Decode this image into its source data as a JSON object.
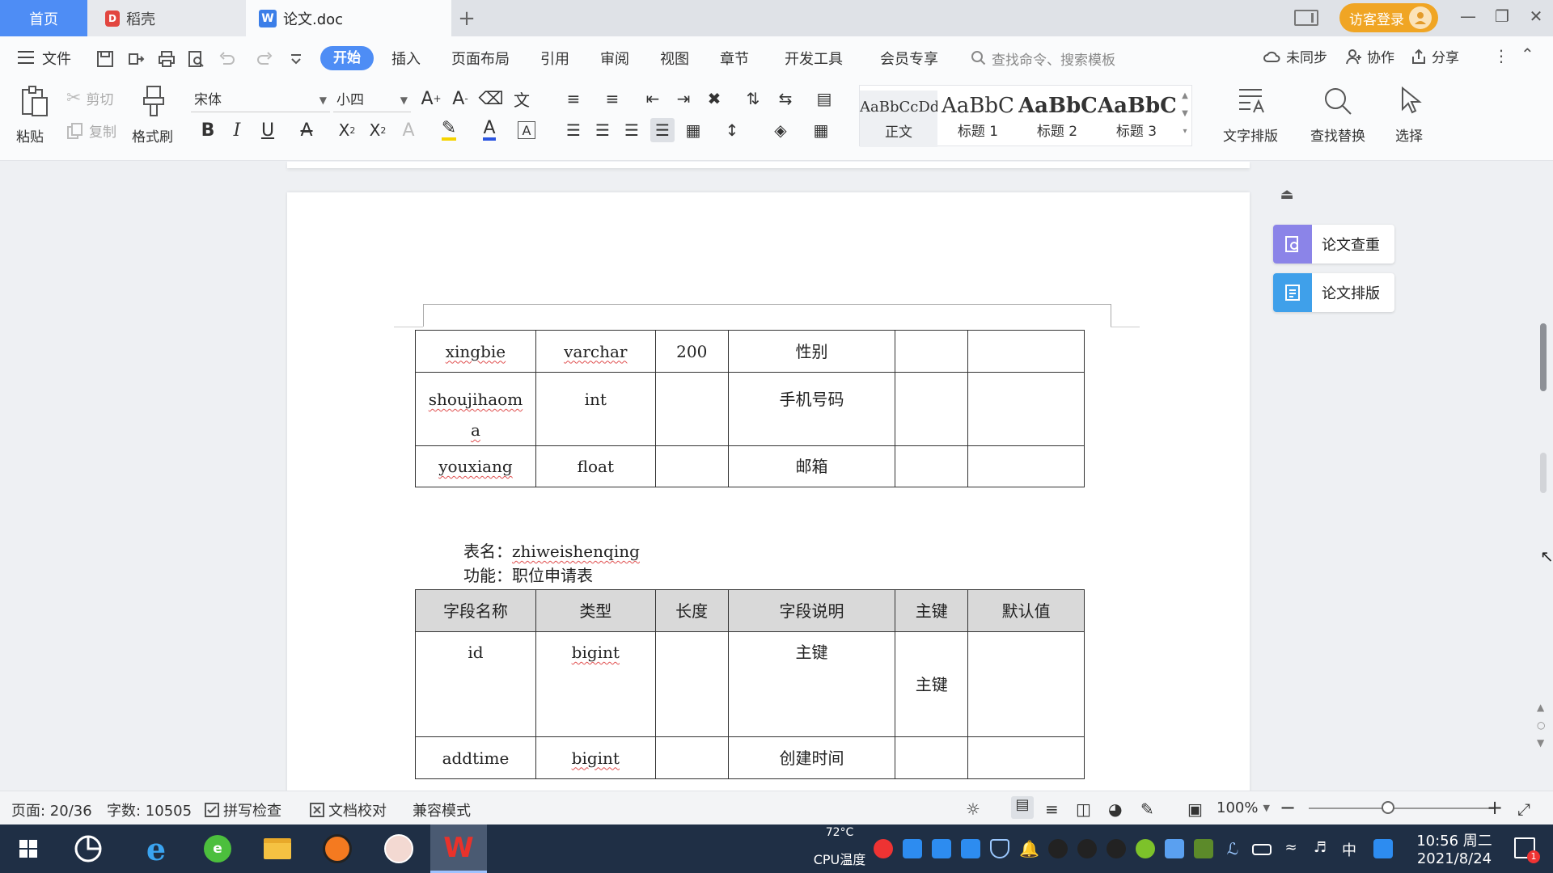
{
  "tabs": {
    "home": "首页",
    "daoke": "稻壳",
    "doc": "论文.doc",
    "add": "+"
  },
  "titlebar": {
    "guest_login": "访客登录"
  },
  "menu": {
    "file": "文件",
    "items": [
      "开始",
      "插入",
      "页面布局",
      "引用",
      "审阅",
      "视图",
      "章节",
      "开发工具",
      "会员专享"
    ],
    "search_placeholder": "查找命令、搜索模板",
    "unsynced": "未同步",
    "collab": "协作",
    "share": "分享"
  },
  "ribbon": {
    "paste": "粘贴",
    "cut": "剪切",
    "copy": "复制",
    "format_painter": "格式刷",
    "font_name": "宋体",
    "font_size": "小四",
    "styles": [
      {
        "sample": "AaBbCcDd",
        "name": "正文"
      },
      {
        "sample": "AaBbC",
        "name": "标题 1"
      },
      {
        "sample": "AaBbC",
        "name": "标题 2"
      },
      {
        "sample": "AaBbC",
        "name": "标题 3"
      }
    ],
    "text_layout": "文字排版",
    "find_replace": "查找替换",
    "select": "选择"
  },
  "document": {
    "table1": [
      {
        "name": "xingbie",
        "type": "varchar",
        "length": "200",
        "desc": "性别",
        "key": "",
        "default": ""
      },
      {
        "name": "shoujihaoma",
        "type": "int",
        "length": "",
        "desc": "手机号码",
        "key": "",
        "default": ""
      },
      {
        "name": "youxiang",
        "type": "float",
        "length": "",
        "desc": "邮箱",
        "key": "",
        "default": ""
      }
    ],
    "table2_name_label": "表名：",
    "table2_name": "zhiweishenqing",
    "table2_func_label": "功能：",
    "table2_func": "职位申请表",
    "table2_headers": [
      "字段名称",
      "类型",
      "长度",
      "字段说明",
      "主键",
      "默认值"
    ],
    "table2": [
      {
        "name": "id",
        "type": "bigint",
        "length": "",
        "desc": "主键",
        "key": "主键",
        "default": ""
      },
      {
        "name": "addtime",
        "type": "bigint",
        "length": "",
        "desc": "创建时间",
        "key": "",
        "default": ""
      }
    ]
  },
  "side_panel": {
    "check": "论文查重",
    "format": "论文排版"
  },
  "status": {
    "page": "页面: 20/36",
    "words": "字数: 10505",
    "spell_check": "拼写检查",
    "doc_proof": "文档校对",
    "compat_mode": "兼容模式",
    "zoom": "100%"
  },
  "taskbar": {
    "temp": "72°C",
    "temp_label": "CPU温度",
    "ime": "中",
    "time": "10:56 周二",
    "date": "2021/8/24"
  },
  "colors": {
    "accent": "#4e8df5",
    "guest": "#f0a524",
    "table_header": "#d9d9d9"
  }
}
